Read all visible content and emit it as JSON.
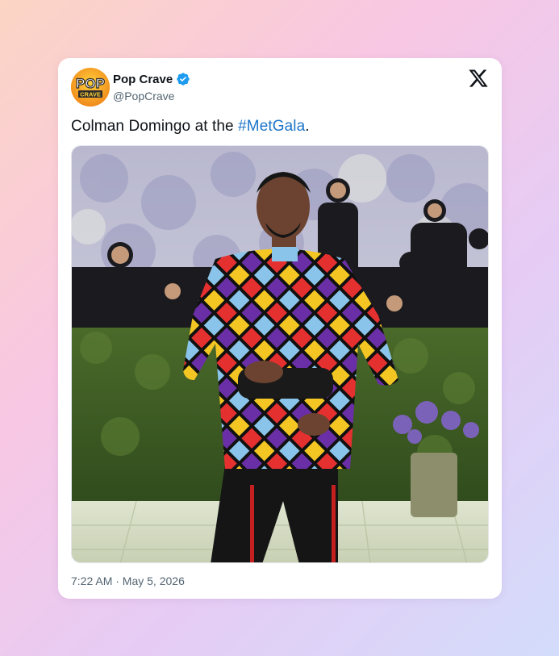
{
  "tweet": {
    "author": {
      "display_name": "Pop Crave",
      "handle": "@PopCrave",
      "verified": true,
      "avatar_text_top": "POP",
      "avatar_text_bottom": "CRAVE",
      "avatar_icon": "pop-crave-logo"
    },
    "text_before": "Colman Domingo at the ",
    "hashtag": "#MetGala",
    "text_after": ".",
    "timestamp": "7:22 AM · May 5, 2026",
    "platform_icon": "x-logo-icon",
    "photo_icon": "tweet-photo"
  },
  "colors": {
    "hashtag": "#1d75c9",
    "verified": "#1d9bf0",
    "text": "#0f1419",
    "muted": "#536471"
  }
}
